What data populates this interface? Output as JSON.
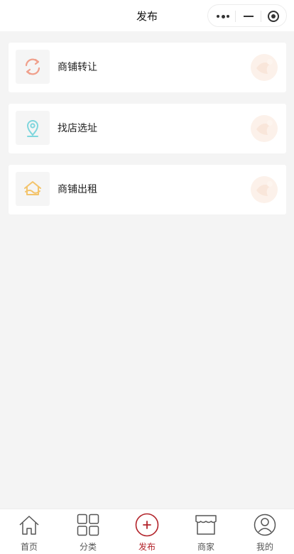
{
  "header": {
    "title": "发布"
  },
  "colors": {
    "accent": "#b2232a",
    "background": "#f4f4f4",
    "icon_transfer": "#f0a08c",
    "icon_location": "#7fd6dd",
    "icon_rent": "#f3c46c"
  },
  "capsule": {
    "more_icon": "more-dots-icon",
    "minimize_icon": "minimize-icon",
    "close_icon": "target-circle-icon"
  },
  "items": [
    {
      "label": "商铺转让",
      "icon": "refresh-arrows-icon"
    },
    {
      "label": "找店选址",
      "icon": "location-pin-icon"
    },
    {
      "label": "商铺出租",
      "icon": "house-icon"
    }
  ],
  "tabbar": {
    "tabs": [
      {
        "label": "首页",
        "icon": "home-icon",
        "active": false
      },
      {
        "label": "分类",
        "icon": "grid-icon",
        "active": false
      },
      {
        "label": "发布",
        "icon": "plus-circle-icon",
        "active": true
      },
      {
        "label": "商家",
        "icon": "store-icon",
        "active": false
      },
      {
        "label": "我的",
        "icon": "user-icon",
        "active": false
      }
    ]
  }
}
